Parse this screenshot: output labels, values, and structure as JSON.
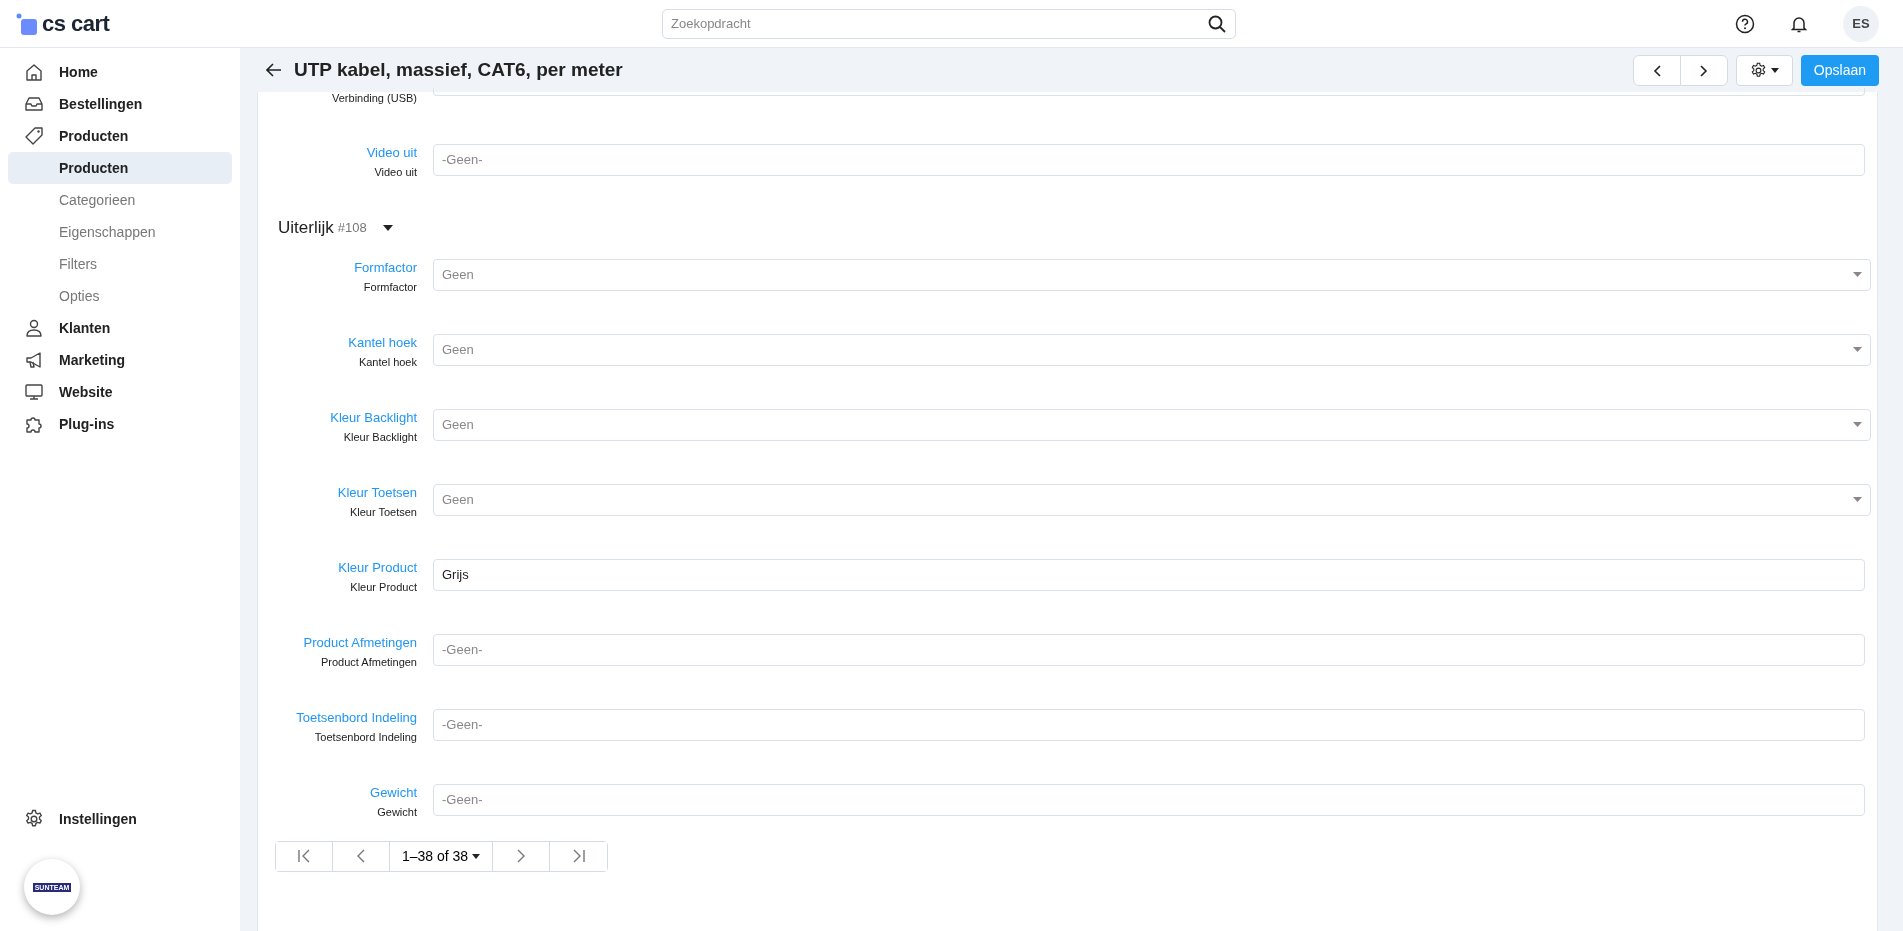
{
  "header": {
    "logo": "cs cart",
    "search": {
      "placeholder": "Zoekopdracht"
    },
    "avatar": "ES"
  },
  "sidebar": {
    "items": [
      {
        "label": "Home"
      },
      {
        "label": "Bestellingen"
      },
      {
        "label": "Producten",
        "children": [
          {
            "label": "Producten",
            "selected": true
          },
          {
            "label": "Categorieen",
            "selected": false
          },
          {
            "label": "Eigenschappen",
            "selected": false
          },
          {
            "label": "Filters",
            "selected": false
          },
          {
            "label": "Opties",
            "selected": false
          }
        ]
      },
      {
        "label": "Klanten"
      },
      {
        "label": "Marketing"
      },
      {
        "label": "Website"
      },
      {
        "label": "Plug-ins"
      }
    ],
    "settings": {
      "label": "Instellingen"
    },
    "company_logo": "SUNTEAM"
  },
  "page": {
    "title": "UTP kabel, massief, CAT6, per meter",
    "save_button": "Opslaan"
  },
  "sections": [
    {
      "fields": [
        {
          "kind": "partial",
          "sublabel": "Verbinding (USB)"
        },
        {
          "kind": "text",
          "label": "Video uit",
          "sublabel": "Video uit",
          "placeholder": "-Geen-"
        }
      ]
    },
    {
      "title": "Uiterlijk",
      "id": "#108",
      "expanded": true,
      "fields": [
        {
          "kind": "select",
          "label": "Formfactor",
          "sublabel": "Formfactor",
          "placeholder": "Geen"
        },
        {
          "kind": "select",
          "label": "Kantel hoek",
          "sublabel": "Kantel hoek",
          "placeholder": "Geen"
        },
        {
          "kind": "select",
          "label": "Kleur Backlight",
          "sublabel": "Kleur Backlight",
          "placeholder": "Geen"
        },
        {
          "kind": "select",
          "label": "Kleur Toetsen",
          "sublabel": "Kleur Toetsen",
          "placeholder": "Geen"
        },
        {
          "kind": "text",
          "label": "Kleur Product",
          "sublabel": "Kleur Product",
          "value": "Grijs"
        },
        {
          "kind": "text",
          "label": "Product Afmetingen",
          "sublabel": "Product Afmetingen",
          "placeholder": "-Geen-"
        },
        {
          "kind": "text",
          "label": "Toetsenbord Indeling",
          "sublabel": "Toetsenbord Indeling",
          "placeholder": "-Geen-"
        },
        {
          "kind": "text",
          "label": "Gewicht",
          "sublabel": "Gewicht",
          "placeholder": "-Geen-"
        }
      ]
    }
  ],
  "pagination": {
    "range": "1–38 of 38"
  }
}
